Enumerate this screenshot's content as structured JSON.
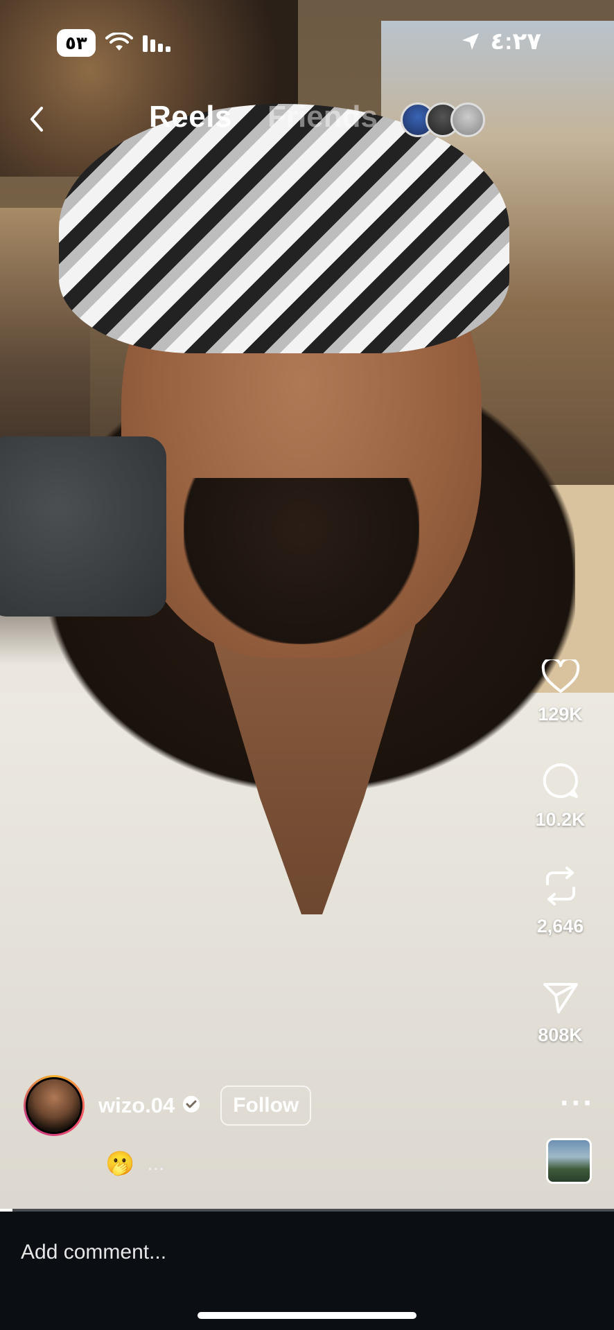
{
  "status_bar": {
    "time": "٤:٢٧",
    "battery": "٥٣"
  },
  "header": {
    "tab_active": "Reels",
    "tab_inactive": "Friends"
  },
  "actions": {
    "likes": "129K",
    "comments": "10.2K",
    "reposts": "2,646",
    "shares": "808K"
  },
  "author": {
    "username": "wizo.04",
    "follow_label": "Follow"
  },
  "caption": {
    "emoji": "🫢",
    "more": "..."
  },
  "comment_bar": {
    "placeholder": "Add comment..."
  },
  "playback": {
    "progress": 0.02
  },
  "icons": [
    "back-arrow-icon",
    "heart-icon",
    "comment-icon",
    "repost-icon",
    "send-icon",
    "more-icon",
    "verified-icon",
    "location-arrow-icon",
    "wifi-icon",
    "signal-icon"
  ]
}
